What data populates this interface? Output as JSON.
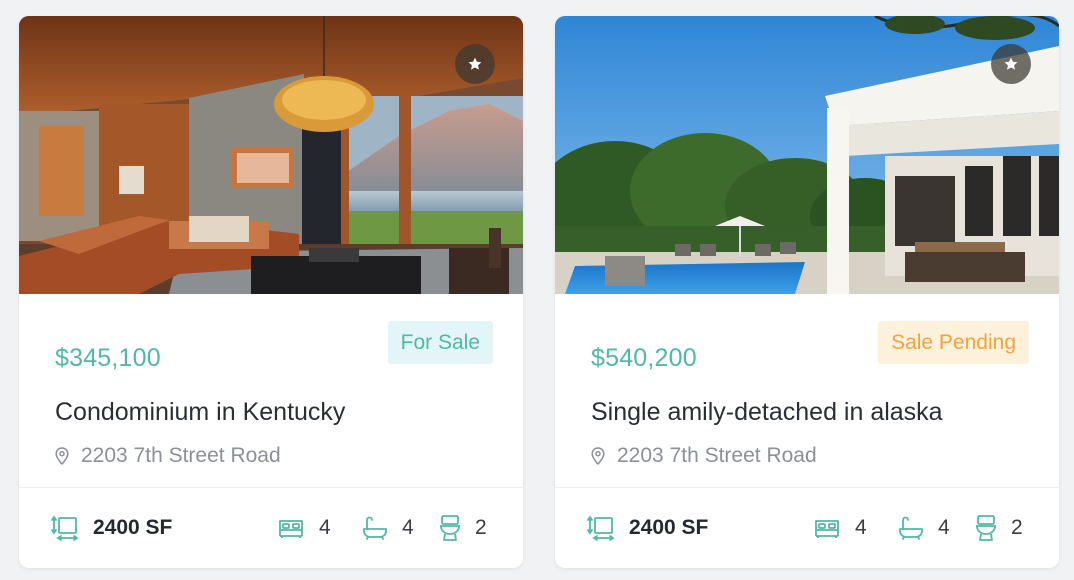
{
  "colors": {
    "accent": "#4fb8a6",
    "for_sale_bg": "#e4f5f7",
    "for_sale_text": "#4fb8a6",
    "pending_bg": "#fdf1dc",
    "pending_text": "#f2a33c"
  },
  "listings": [
    {
      "price": "$345,100",
      "status": "For Sale",
      "title": "Condominium in Kentucky",
      "address": "2203 7th Street Road",
      "area": "2400 SF",
      "beds": "4",
      "baths": "4",
      "toilets": "2",
      "icons": [
        "star-icon",
        "map-pin-icon",
        "area-icon",
        "bed-icon",
        "bathtub-icon",
        "toilet-icon"
      ]
    },
    {
      "price": "$540,200",
      "status": "Sale Pending",
      "title": "Single amily-detached in alaska",
      "address": "2203 7th Street Road",
      "area": "2400 SF",
      "beds": "4",
      "baths": "4",
      "toilets": "2",
      "icons": [
        "star-icon",
        "map-pin-icon",
        "area-icon",
        "bed-icon",
        "bathtub-icon",
        "toilet-icon"
      ]
    }
  ]
}
